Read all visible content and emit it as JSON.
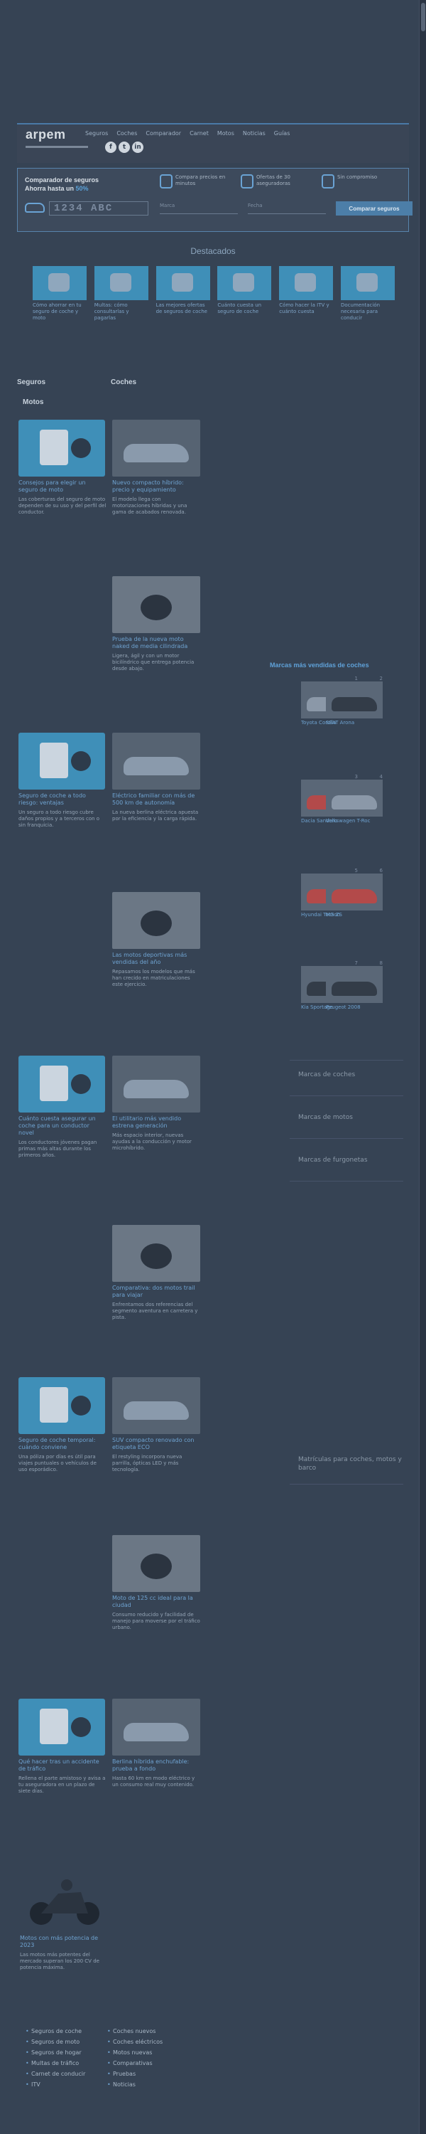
{
  "header": {
    "logo": "arpem",
    "nav": [
      "Seguros",
      "Coches",
      "Comparador",
      "Carnet",
      "Motos",
      "Noticias",
      "Guías"
    ],
    "social": [
      "f",
      "t",
      "in"
    ]
  },
  "comparator": {
    "title_line1": "Comparador de seguros",
    "title_line2_prefix": "Ahorra hasta un ",
    "title_line2_highlight": "50%",
    "features": [
      "Compara precios en minutos",
      "Ofertas de 30 aseguradoras",
      "Sin compromiso"
    ],
    "plate_placeholder": "1234 ABC",
    "field1": "Marca",
    "field2": "Fecha",
    "button": "Comparar seguros"
  },
  "sections": {
    "destacados": "Destacados",
    "seguros": "Seguros",
    "coches": "Coches",
    "motos": "Motos",
    "ranking": "Marcas más vendidas de coches"
  },
  "topics": [
    "Cómo ahorrar en tu seguro de coche y moto",
    "Multas: cómo consultarlas y pagarlas",
    "Las mejores ofertas de seguros de coche",
    "Cuánto cuesta un seguro de coche",
    "Cómo hacer la ITV y cuánto cuesta",
    "Documentación necesaria para conducir"
  ],
  "seguros_cards": [
    {
      "title": "Consejos para elegir un seguro de moto",
      "text": "Las coberturas del seguro de moto dependen de su uso y del perfil del conductor."
    },
    {
      "title": "Seguro de coche a todo riesgo: ventajas",
      "text": "Un seguro a todo riesgo cubre daños propios y a terceros con o sin franquicia."
    },
    {
      "title": "Cuánto cuesta asegurar un coche para un conductor novel",
      "text": "Los conductores jóvenes pagan primas más altas durante los primeros años."
    },
    {
      "title": "Seguro de coche temporal: cuándo conviene",
      "text": "Una póliza por días es útil para viajes puntuales o vehículos de uso esporádico."
    },
    {
      "title": "Qué hacer tras un accidente de tráfico",
      "text": "Rellena el parte amistoso y avisa a tu aseguradora en un plazo de siete días."
    }
  ],
  "coches_cards": [
    {
      "title": "Nuevo compacto híbrido: precio y equipamiento",
      "text": "El modelo llega con motorizaciones híbridas y una gama de acabados renovada."
    },
    {
      "title": "Prueba de la nueva moto naked de media cilindrada",
      "text": "Ligera, ágil y con un motor bicilíndrico que entrega potencia desde abajo."
    },
    {
      "title": "Eléctrico familiar con más de 500 km de autonomía",
      "text": "La nueva berlina eléctrica apuesta por la eficiencia y la carga rápida."
    },
    {
      "title": "Las motos deportivas más vendidas del año",
      "text": "Repasamos los modelos que más han crecido en matriculaciones este ejercicio."
    },
    {
      "title": "El utilitario más vendido estrena generación",
      "text": "Más espacio interior, nuevas ayudas a la conducción y motor microhíbrido."
    },
    {
      "title": "Comparativa: dos motos trail para viajar",
      "text": "Enfrentamos dos referencias del segmento aventura en carretera y pista."
    },
    {
      "title": "SUV compacto renovado con etiqueta ECO",
      "text": "El restyling incorpora nueva parrilla, ópticas LED y más tecnología."
    },
    {
      "title": "Moto de 125 cc ideal para la ciudad",
      "text": "Consumo reducido y facilidad de manejo para moverse por el tráfico urbano."
    },
    {
      "title": "Berlina híbrida enchufable: prueba a fondo",
      "text": "Hasta 60 km en modo eléctrico y un consumo real muy contenido."
    }
  ],
  "bottom_card": {
    "title": "Motos con más potencia de 2023",
    "text": "Las motos más potentes del mercado superan los 200 CV de potencia máxima."
  },
  "ranking": [
    {
      "num": "1",
      "cap": "Toyota Corolla"
    },
    {
      "num": "2",
      "cap": "SEAT Arona"
    },
    {
      "num": "3",
      "cap": "Dacia Sandero"
    },
    {
      "num": "4",
      "cap": "Volkswagen T-Roc"
    },
    {
      "num": "5",
      "cap": "Hyundai Tucson"
    },
    {
      "num": "6",
      "cap": "MG ZS"
    },
    {
      "num": "7",
      "cap": "Kia Sportage"
    },
    {
      "num": "8",
      "cap": "Peugeot 2008"
    }
  ],
  "side_links": [
    "Marcas de coches",
    "Marcas de motos",
    "Marcas de furgonetas",
    "Matrículas para coches, motos y barco"
  ],
  "footer_links_left": [
    "Seguros de coche",
    "Seguros de moto",
    "Seguros de hogar",
    "Multas de tráfico",
    "Carnet de conducir",
    "ITV"
  ],
  "footer_links_right": [
    "Coches nuevos",
    "Coches eléctricos",
    "Motos nuevas",
    "Comparativas",
    "Pruebas",
    "Noticias"
  ]
}
